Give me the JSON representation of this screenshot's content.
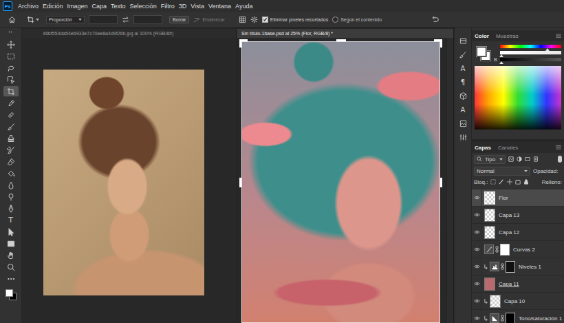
{
  "app": {
    "logo": "Ps"
  },
  "menu": [
    "Archivo",
    "Edición",
    "Imagen",
    "Capa",
    "Texto",
    "Selección",
    "Filtro",
    "3D",
    "Vista",
    "Ventana",
    "Ayuda"
  ],
  "options_bar": {
    "ratio": "Proporción",
    "clear_button": "Borrar",
    "straighten": {
      "label": "Enderezar",
      "disabled": true
    },
    "delete_cropped": {
      "label": "Eliminar píxeles recortados",
      "checked": true
    },
    "content_aware": {
      "label": "Según el contenido",
      "checked": false
    }
  },
  "tools": [
    {
      "selected": false
    },
    {
      "selected": false
    },
    {
      "selected": false
    },
    {
      "selected": false
    },
    {
      "selected": true
    },
    {
      "selected": false
    },
    {
      "selected": false
    },
    {
      "selected": false
    },
    {
      "selected": false
    },
    {
      "selected": false
    },
    {
      "selected": false
    },
    {
      "selected": false
    },
    {
      "selected": false
    },
    {
      "selected": false
    },
    {
      "selected": false
    },
    {
      "selected": false,
      "glyph": "T"
    },
    {
      "selected": false
    },
    {
      "selected": false
    },
    {
      "selected": false
    },
    {
      "selected": false
    },
    {
      "selected": false
    },
    {
      "selected": false
    }
  ],
  "documents": [
    {
      "title": "46bf554da54e6933e7c70ee8a4d9f26b.jpg al 100% (RGB/8#)",
      "selected": false
    },
    {
      "title": "Sin título-1base.psd al 25% (Flor, RGB/8) *",
      "selected": true
    }
  ],
  "dock": [
    {
      "kind": "icon"
    },
    {
      "kind": "icon"
    },
    {
      "kind": "glyph",
      "glyph": "A"
    },
    {
      "kind": "glyph",
      "glyph": "¶"
    },
    {
      "kind": "icon"
    },
    {
      "kind": "glyph",
      "glyph": "A"
    },
    {
      "kind": "icon"
    },
    {
      "kind": "icon"
    }
  ],
  "color_panel": {
    "tabs": [
      {
        "label": "Color",
        "selected": true
      },
      {
        "label": "Muestras",
        "selected": false
      }
    ],
    "sliders": [
      {
        "level": 0.77
      },
      {
        "level": 0.02
      },
      {
        "label": "B",
        "level": 0.02
      }
    ]
  },
  "layers_panel": {
    "tabs": [
      {
        "label": "Capas",
        "selected": true
      },
      {
        "label": "Canales",
        "selected": false
      }
    ],
    "filter": "Tipo",
    "blend_mode": "Normal",
    "opacity_label": "Opacidad:",
    "lock_label": "Bloq.:",
    "fill_label": "Relleno:",
    "layers": [
      {
        "name": "Flor",
        "kind": "pixel",
        "selected": true,
        "visible": true,
        "clipped": false,
        "base": false,
        "thumb_color": null
      },
      {
        "name": "Capa 13",
        "kind": "pixel",
        "selected": false,
        "visible": true,
        "clipped": false,
        "base": false,
        "thumb_color": null
      },
      {
        "name": "Capa 12",
        "kind": "pixel",
        "selected": false,
        "visible": true,
        "clipped": false,
        "base": false,
        "thumb_color": null
      },
      {
        "name": "Curvas 2",
        "kind": "curves",
        "selected": false,
        "visible": true,
        "clipped": false,
        "base": false,
        "mask_color": "#ffffff"
      },
      {
        "name": "Niveles 1",
        "kind": "levels",
        "selected": false,
        "visible": true,
        "clipped": true,
        "base": false,
        "mask_color": "#111111"
      },
      {
        "name": "Capa 11",
        "kind": "pixel",
        "selected": false,
        "visible": true,
        "clipped": false,
        "base": true,
        "thumb_color": "#b86a6e"
      },
      {
        "name": "Capa 10",
        "kind": "pixel",
        "selected": false,
        "visible": true,
        "clipped": true,
        "base": false,
        "thumb_color": null
      },
      {
        "name": "Tono/saturación 1",
        "kind": "hue",
        "selected": false,
        "visible": true,
        "clipped": true,
        "base": false,
        "mask_color": "#000000"
      }
    ]
  }
}
